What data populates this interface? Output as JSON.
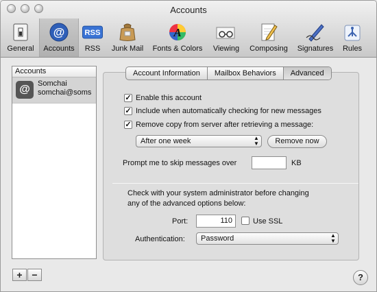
{
  "window": {
    "title": "Accounts"
  },
  "toolbar": {
    "items": [
      {
        "label": "General",
        "icon": "general-switch-icon"
      },
      {
        "label": "Accounts",
        "icon": "at-sign-icon",
        "icon_glyph": "@"
      },
      {
        "label": "RSS",
        "icon": "rss-icon",
        "icon_glyph": "RSS"
      },
      {
        "label": "Junk Mail",
        "icon": "junk-mail-bag-icon"
      },
      {
        "label": "Fonts & Colors",
        "icon": "fonts-colors-icon",
        "icon_glyph": "A"
      },
      {
        "label": "Viewing",
        "icon": "viewing-glasses-icon"
      },
      {
        "label": "Composing",
        "icon": "composing-pencil-icon"
      },
      {
        "label": "Signatures",
        "icon": "signatures-pen-icon"
      },
      {
        "label": "Rules",
        "icon": "rules-icon"
      }
    ],
    "selected": "Accounts"
  },
  "sidebar": {
    "header": "Accounts",
    "accounts": [
      {
        "name": "Somchai",
        "email": "somchai@soms",
        "icon_glyph": "@"
      }
    ],
    "add_label": "+",
    "remove_label": "−"
  },
  "tabs": [
    {
      "label": "Account Information"
    },
    {
      "label": "Mailbox Behaviors"
    },
    {
      "label": "Advanced"
    }
  ],
  "advanced": {
    "enable_account": {
      "label": "Enable this account",
      "checked": true,
      "mark": "✓"
    },
    "include_checking": {
      "label": "Include when automatically checking for new messages",
      "checked": true,
      "mark": "✓"
    },
    "remove_copy": {
      "label": "Remove copy from server after retrieving a message:",
      "checked": true,
      "mark": "✓"
    },
    "remove_after": {
      "selected": "After one week"
    },
    "remove_now_label": "Remove now",
    "prompt_label": "Prompt me to skip messages over",
    "prompt_value": "",
    "prompt_unit": "KB",
    "admin_note_line1": "Check with your system administrator before changing",
    "admin_note_line2": "any of the advanced options below:",
    "port_label": "Port:",
    "port_value": "110",
    "use_ssl": {
      "label": "Use SSL",
      "checked": false
    },
    "auth_label": "Authentication:",
    "auth_selected": "Password"
  },
  "help_label": "?"
}
